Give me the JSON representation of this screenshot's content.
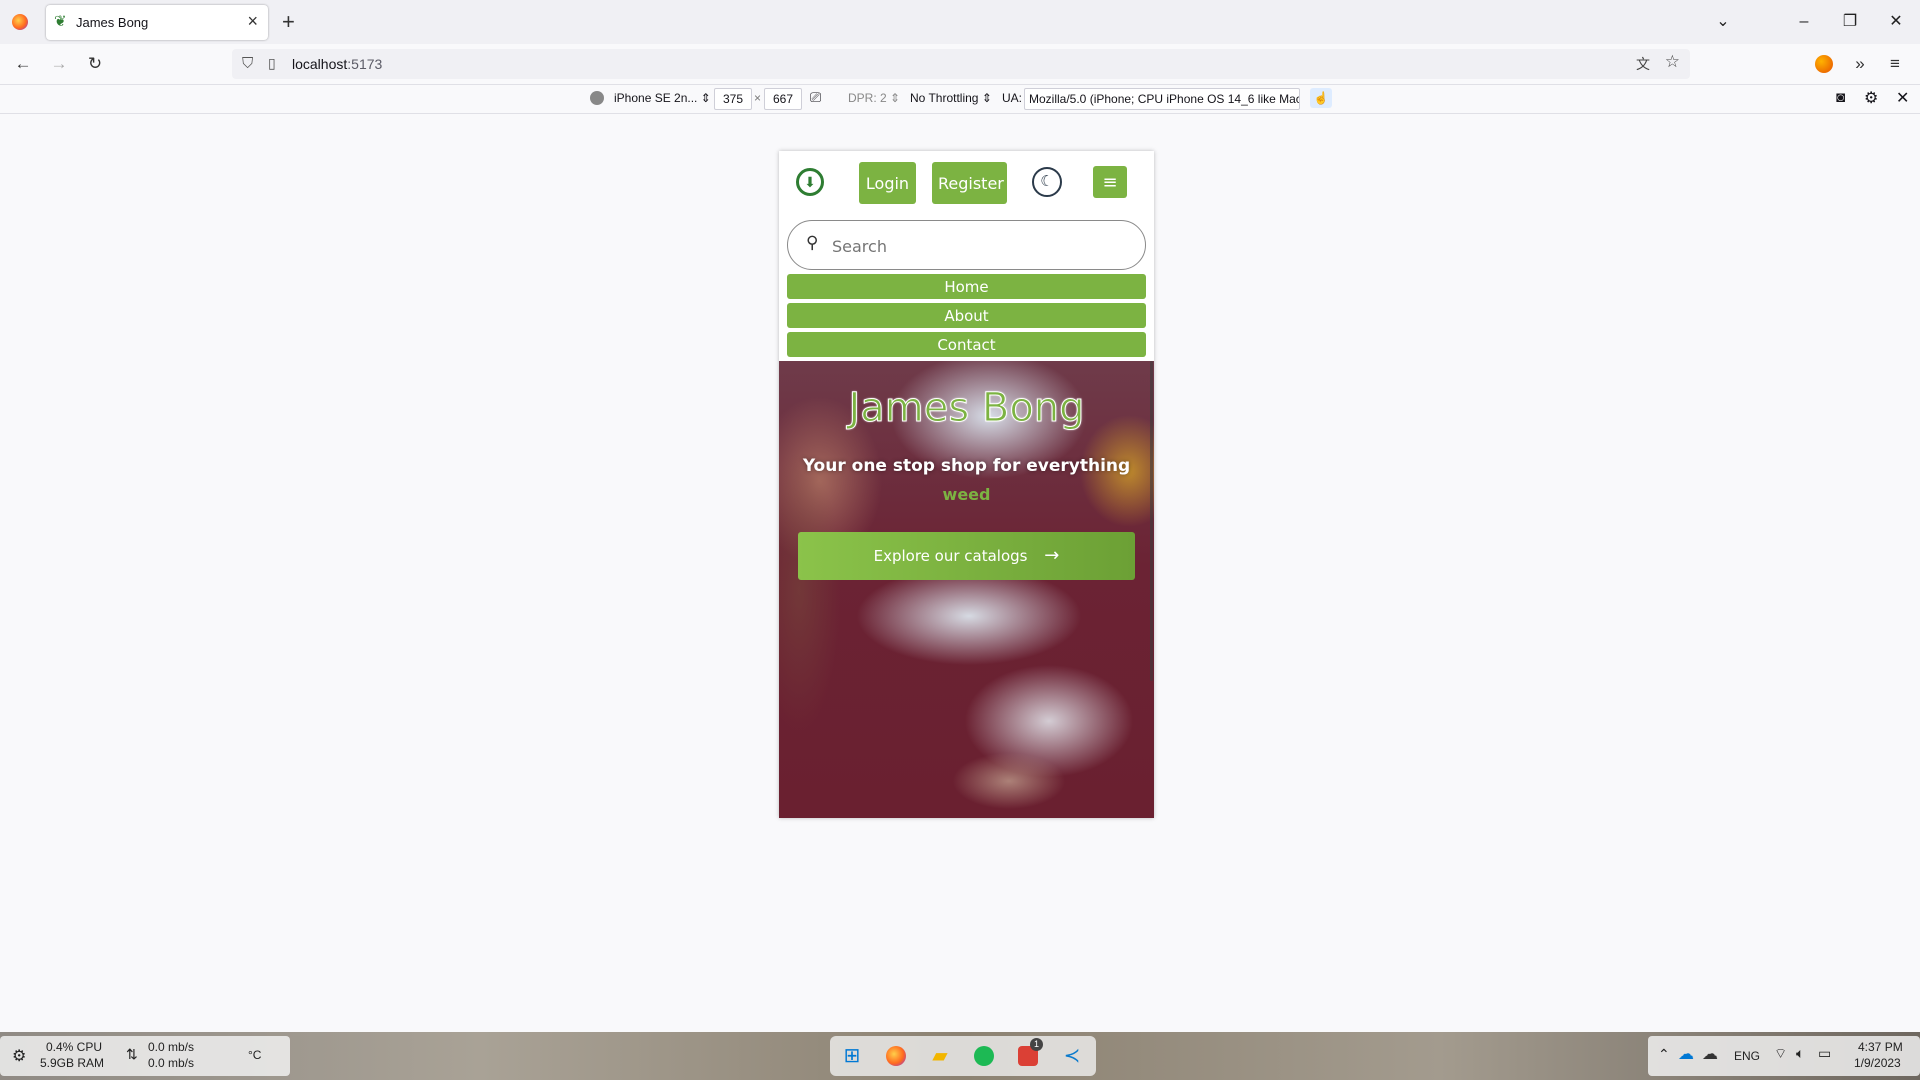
{
  "browser": {
    "tab_title": "James Bong",
    "new_tab_label": "+",
    "url_host": "localhost",
    "url_port": ":5173"
  },
  "rdm": {
    "device": "iPhone SE 2n...",
    "width": "375",
    "times": "×",
    "height": "667",
    "dpr": "DPR: 2",
    "throttling": "No Throttling",
    "ua_label": "UA:",
    "ua_value": "Mozilla/5.0 (iPhone; CPU iPhone OS 14_6 like Mac"
  },
  "site": {
    "login_label": "Login",
    "register_label": "Register",
    "menu_icon": "≡",
    "search_placeholder": "Search",
    "nav": [
      "Home",
      "About",
      "Contact"
    ],
    "hero_title": "James Bong",
    "hero_subtitle": "Your one stop shop for everything",
    "hero_accent_word": "weed",
    "cta_label": "Explore our catalogs",
    "accent_color": "#7cb342"
  },
  "taskbar": {
    "cpu": "0.4% CPU",
    "ram": "5.9GB RAM",
    "net_up": "0.0 mb/s",
    "net_down": "0.0 mb/s",
    "temp": "°C",
    "lang": "ENG",
    "time": "4:37 PM",
    "date": "1/9/2023",
    "badge": "1"
  }
}
